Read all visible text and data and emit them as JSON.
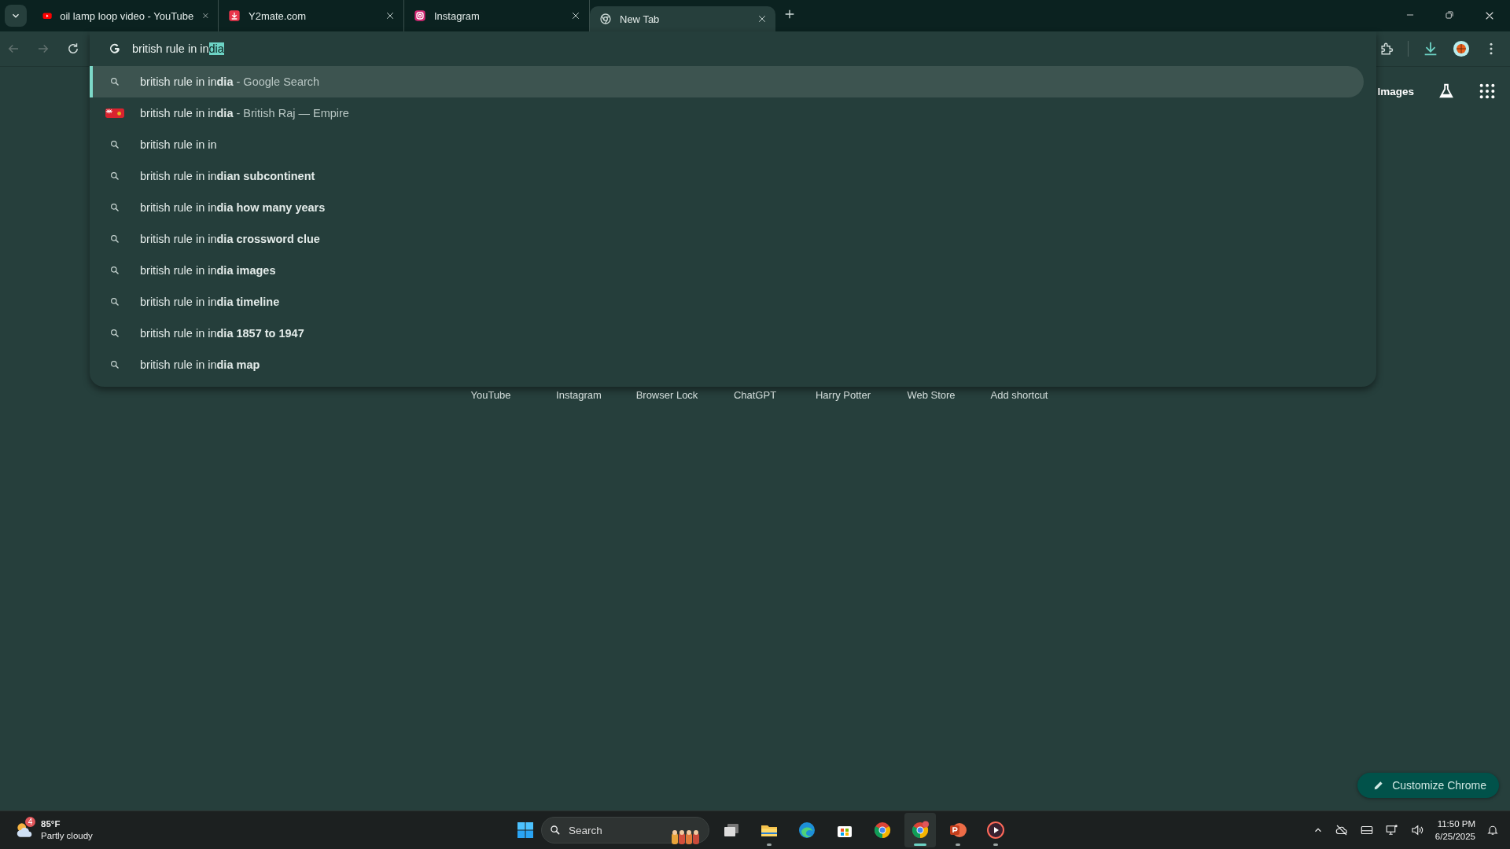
{
  "tabs": [
    {
      "title": "oil lamp loop video - YouTube",
      "kind": "youtube",
      "selected": false
    },
    {
      "title": "Y2mate.com",
      "kind": "download",
      "selected": false
    },
    {
      "title": "Instagram",
      "kind": "instagram",
      "selected": false
    },
    {
      "title": "New Tab",
      "kind": "chrome",
      "selected": true
    }
  ],
  "omnibox": {
    "typed": "british rule in in",
    "autocomplete": "dia"
  },
  "suggestions": [
    {
      "kind": "search",
      "text": "british rule in in**dia**",
      "detail": "- Google Search",
      "selected": true
    },
    {
      "kind": "entity",
      "text": "british rule in in**dia**",
      "detail": "- British Raj — Empire",
      "selected": false
    },
    {
      "kind": "search",
      "text": "british rule in in",
      "selected": false
    },
    {
      "kind": "search",
      "text": "british rule in in**dian subcontinent**",
      "selected": false
    },
    {
      "kind": "search",
      "text": "british rule in in**dia how many years**",
      "selected": false
    },
    {
      "kind": "search",
      "text": "british rule in in**dia crossword clue**",
      "selected": false
    },
    {
      "kind": "search",
      "text": "british rule in in**dia images**",
      "selected": false
    },
    {
      "kind": "search",
      "text": "british rule in in**dia timeline**",
      "selected": false
    },
    {
      "kind": "search",
      "text": "british rule in in**dia 1857 to 1947**",
      "selected": false
    },
    {
      "kind": "search",
      "text": "british rule in in**dia map**",
      "selected": false
    }
  ],
  "ntp_header": {
    "images_link": "Images"
  },
  "shortcuts": [
    "YouTube",
    "Instagram",
    "Browser Lock",
    "ChatGPT",
    "Harry Potter",
    "Web Store",
    "Add shortcut"
  ],
  "customize_button": "Customize Chrome",
  "taskbar": {
    "weather": {
      "badge": "4",
      "temperature": "85°F",
      "condition": "Partly cloudy"
    },
    "search": {
      "placeholder": "Search"
    },
    "apps": [
      {
        "kind": "taskview",
        "running": false,
        "selected": false
      },
      {
        "kind": "explorer",
        "running": true,
        "selected": false
      },
      {
        "kind": "edge",
        "running": false,
        "selected": false
      },
      {
        "kind": "store",
        "running": false,
        "selected": false
      },
      {
        "kind": "chrome",
        "running": false,
        "selected": false
      },
      {
        "kind": "chrome-profile",
        "running": true,
        "selected": true
      },
      {
        "kind": "powerpoint",
        "running": true,
        "selected": false
      },
      {
        "kind": "player",
        "running": true,
        "selected": false
      }
    ],
    "time": "11:50 PM",
    "date": "6/25/2025"
  }
}
